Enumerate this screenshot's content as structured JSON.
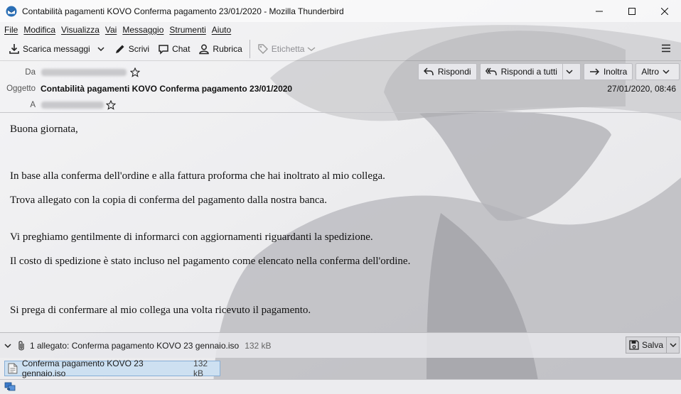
{
  "window": {
    "title": "Contabilità pagamenti KOVO Conferma pagamento 23/01/2020 - Mozilla Thunderbird"
  },
  "menu": [
    {
      "u": "F",
      "rest": "ile"
    },
    {
      "u": "M",
      "rest": "odifica"
    },
    {
      "u": "V",
      "rest": "isualizza"
    },
    {
      "u": "V",
      "rest": "ai"
    },
    {
      "u": "M",
      "rest": "essaggio"
    },
    {
      "u": "S",
      "rest": "trumenti"
    },
    {
      "u": "A",
      "rest": "iuto"
    }
  ],
  "toolbar": {
    "get_messages": "Scarica messaggi",
    "write": "Scrivi",
    "chat": "Chat",
    "address_book": "Rubrica",
    "tag": "Etichetta"
  },
  "header": {
    "from_label": "Da",
    "subject_label": "Oggetto",
    "to_label": "A",
    "subject": "Contabilità pagamenti KOVO Conferma pagamento 23/01/2020",
    "date": "27/01/2020, 08:46",
    "reply": "Rispondi",
    "reply_all": "Rispondi a tutti",
    "forward": "Inoltra",
    "more": "Altro"
  },
  "body": {
    "p1": "Buona giornata,",
    "p2": "In base alla conferma dell'ordine e alla fattura proforma che hai inoltrato al mio collega.",
    "p3": "Trova allegato con la copia di conferma del pagamento dalla nostra banca.",
    "p4": "Vi preghiamo gentilmente di informarci con aggiornamenti riguardanti la spedizione.",
    "p5": "Il costo di spedizione è stato incluso nel pagamento come elencato nella conferma dell'ordine.",
    "p6": "Si prega di confermare al mio collega una volta ricevuto il pagamento."
  },
  "attachments": {
    "summary": "1 allegato: Conferma pagamento KOVO 23 gennaio.iso",
    "summary_size": "132 kB",
    "save": "Salva",
    "item_name": "Conferma pagamento KOVO 23 gennaio.iso",
    "item_size": "132 kB"
  },
  "colors": {
    "accent": "#2b6fb6",
    "selection": "#cde0f1"
  }
}
